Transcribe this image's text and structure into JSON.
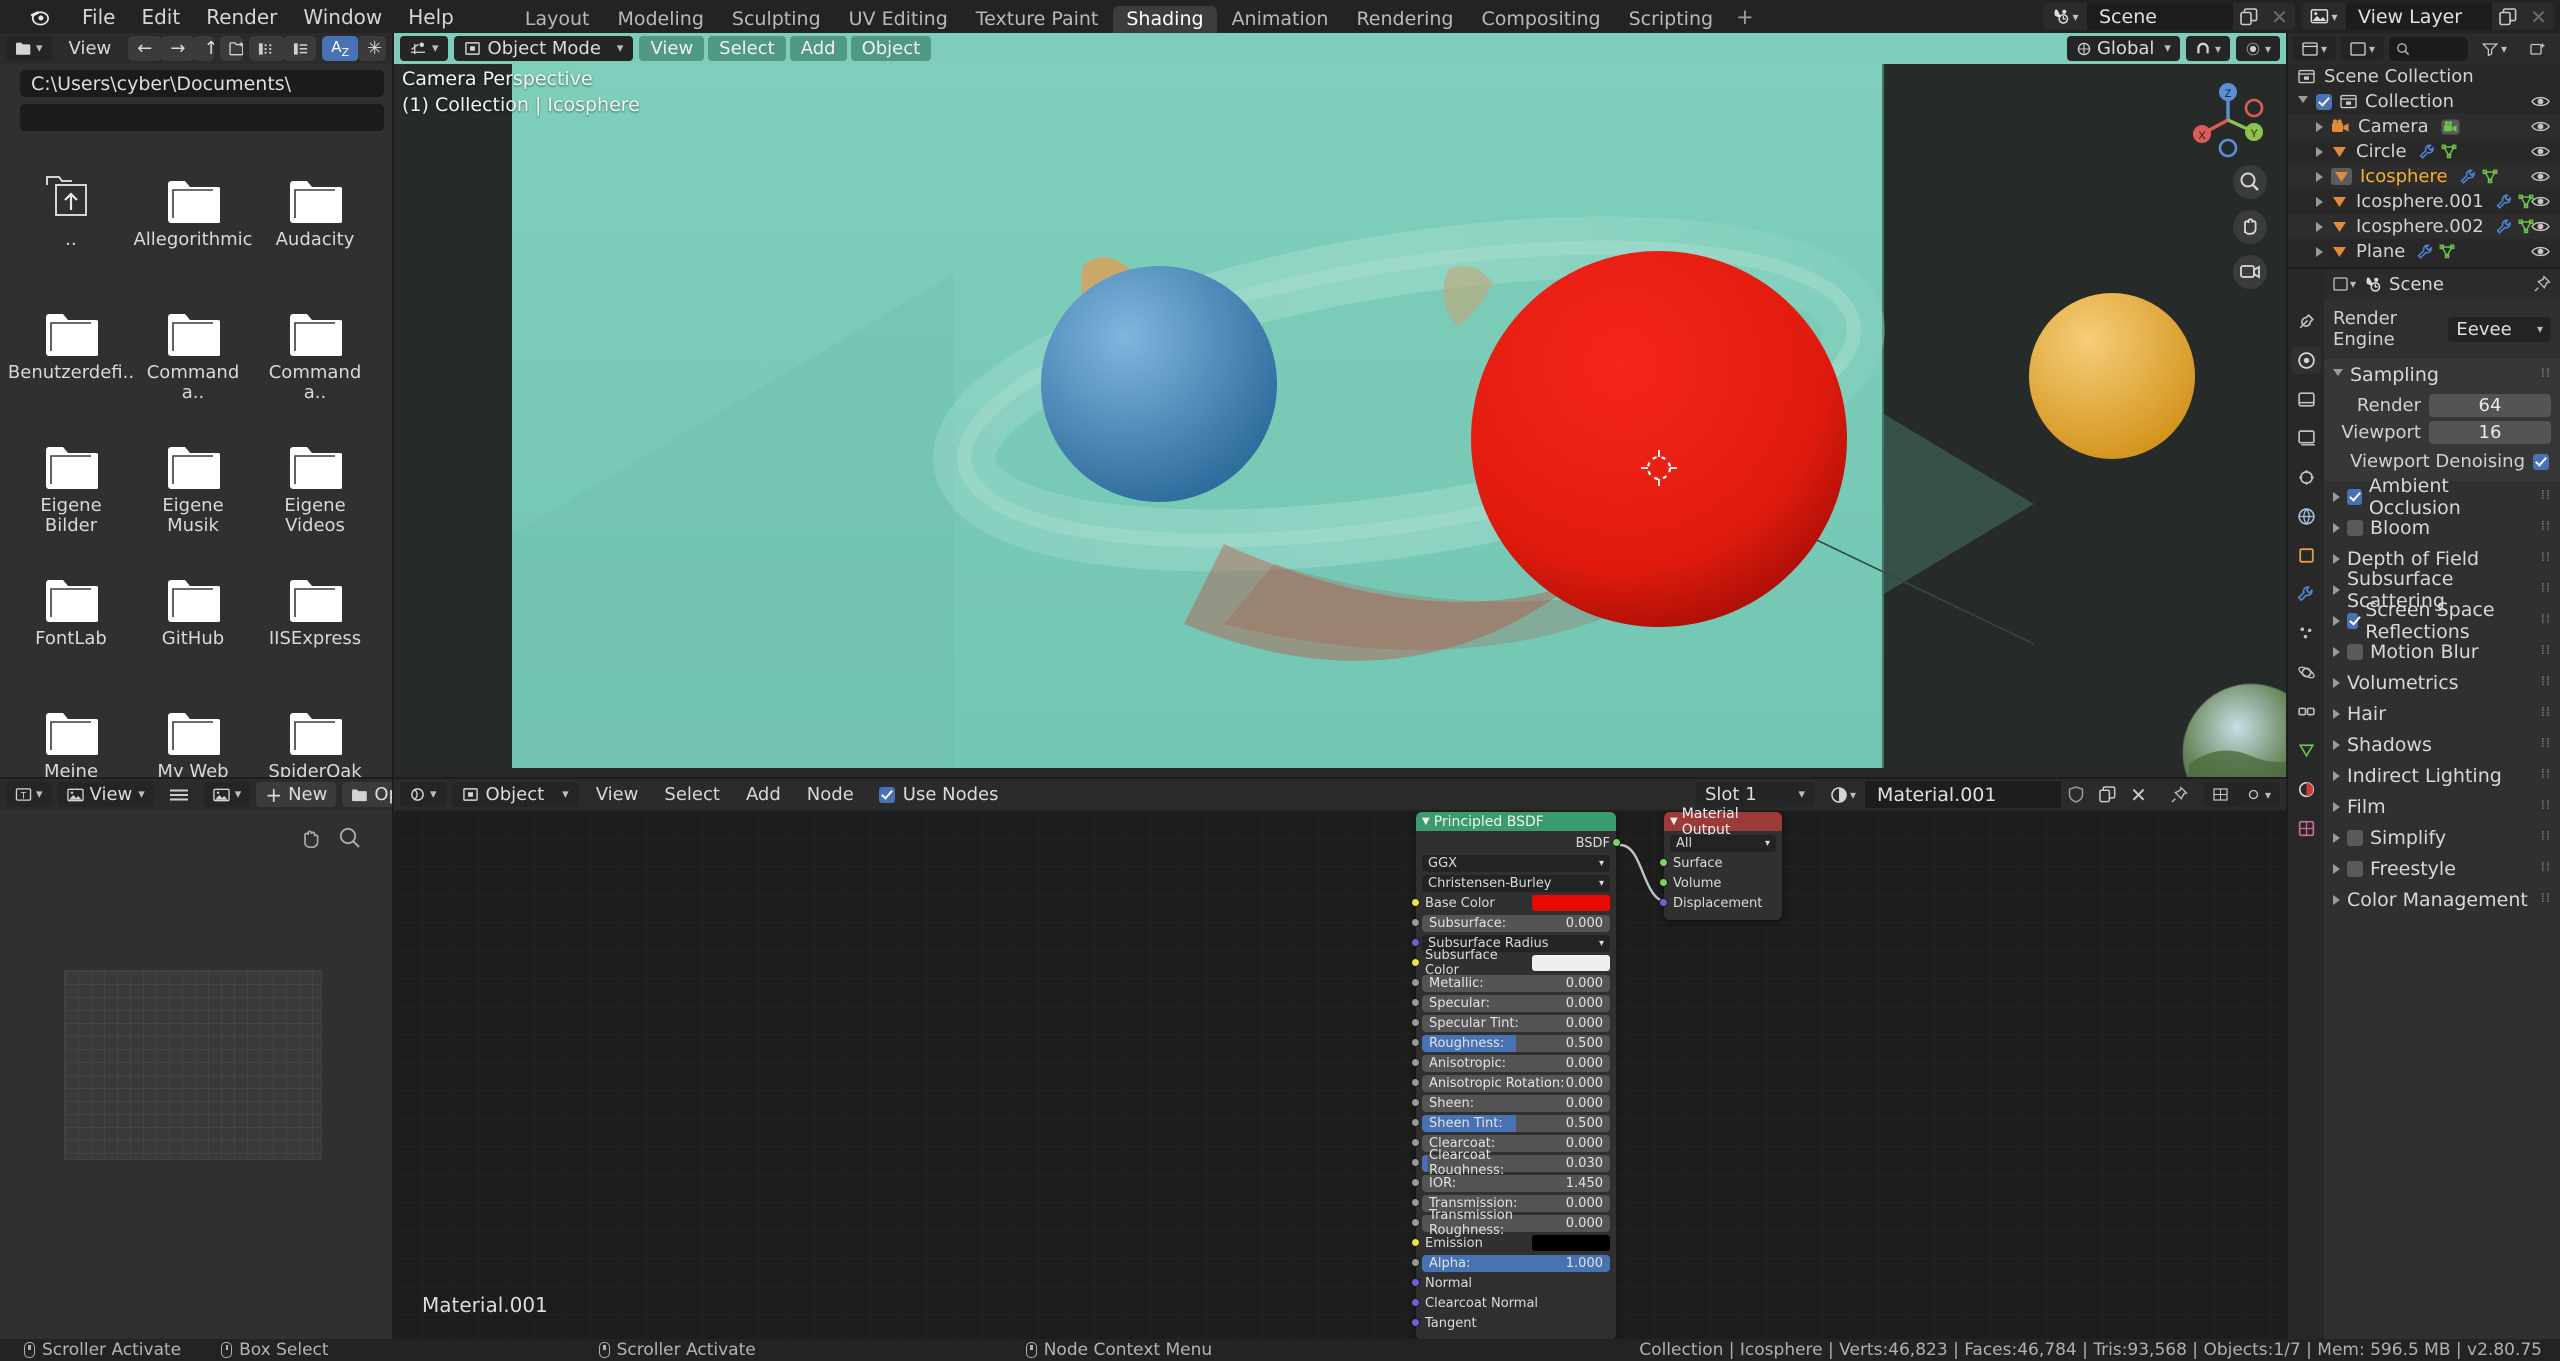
{
  "app": {
    "name": "Blender",
    "version_status": "v2.80.75"
  },
  "topbar": {
    "menus": [
      "File",
      "Edit",
      "Render",
      "Window",
      "Help"
    ],
    "workspace_tabs": [
      {
        "label": "Layout",
        "active": false
      },
      {
        "label": "Modeling",
        "active": false
      },
      {
        "label": "Sculpting",
        "active": false
      },
      {
        "label": "UV Editing",
        "active": false
      },
      {
        "label": "Texture Paint",
        "active": false
      },
      {
        "label": "Shading",
        "active": true
      },
      {
        "label": "Animation",
        "active": false
      },
      {
        "label": "Rendering",
        "active": false
      },
      {
        "label": "Compositing",
        "active": false
      },
      {
        "label": "Scripting",
        "active": false
      }
    ],
    "add_workspace_label": "+",
    "scene": {
      "label": "Scene",
      "icon": "scene-icon"
    },
    "view_layer": {
      "label": "View Layer",
      "icon": "view-layer-icon"
    }
  },
  "filebrowser": {
    "editor_type_icon": "file-browser-icon",
    "view_menu": "View",
    "path": "C:\\Users\\cyber\\Documents\\",
    "filename": "",
    "items": [
      {
        "label": "..",
        "icon": "parent-folder-icon"
      },
      {
        "label": "Allegorithmic",
        "icon": "folder-icon"
      },
      {
        "label": "Audacity",
        "icon": "folder-icon"
      },
      {
        "label": "Benutzerdefi..",
        "icon": "folder-icon"
      },
      {
        "label": "Command a..",
        "icon": "folder-icon"
      },
      {
        "label": "Command a..",
        "icon": "folder-icon"
      },
      {
        "label": "Eigene Bilder",
        "icon": "folder-icon"
      },
      {
        "label": "Eigene Musik",
        "icon": "folder-icon"
      },
      {
        "label": "Eigene Videos",
        "icon": "folder-icon"
      },
      {
        "label": "FontLab",
        "icon": "folder-icon"
      },
      {
        "label": "GitHub",
        "icon": "folder-icon"
      },
      {
        "label": "IISExpress",
        "icon": "folder-icon"
      },
      {
        "label": "Meine Shapes",
        "icon": "folder-icon"
      },
      {
        "label": "My Web Sites",
        "icon": "folder-icon"
      },
      {
        "label": "SpiderOak Hi..",
        "icon": "folder-icon"
      }
    ]
  },
  "image_editor": {
    "editor_type_icon": "image-editor-icon",
    "view_menu": "View",
    "image_icon": "image-icon",
    "new_label": "New",
    "open_label": "Open"
  },
  "viewport": {
    "mode": "Object Mode",
    "menus": [
      "View",
      "Select",
      "Add",
      "Object"
    ],
    "transform_orientation": "Global",
    "overlay_text_line1": "Camera Perspective",
    "overlay_text_line2": "(1) Collection | Icosphere",
    "gizmo_axes": [
      "X",
      "Y",
      "Z"
    ],
    "colors": {
      "world_bg": "#7fccbb",
      "sphere_blue": "#4a8fc9",
      "sphere_red": "#e01b0e",
      "sphere_orange": "#e8a838",
      "sphere_gray": "#9d9d9d"
    }
  },
  "shader_editor": {
    "editor_type_icon": "shader-editor-icon",
    "shader_type": "Object",
    "menus": [
      "View",
      "Select",
      "Add",
      "Node"
    ],
    "use_nodes_label": "Use Nodes",
    "use_nodes_checked": true,
    "slot": "Slot 1",
    "material": "Material.001",
    "material_label_overlay": "Material.001",
    "nodes": [
      {
        "name": "Principled BSDF",
        "header_color": "#3a9b6e",
        "output_socket": "BSDF",
        "dropdowns": [
          "GGX",
          "Christensen-Burley"
        ],
        "rows": [
          {
            "type": "color",
            "label": "Base Color",
            "color": "#e60c05",
            "socket": "yellow"
          },
          {
            "type": "value",
            "label": "Subsurface:",
            "value": "0.000",
            "fill": 0,
            "socket": "gray"
          },
          {
            "type": "dropdown",
            "label": "Subsurface Radius",
            "socket": "blue"
          },
          {
            "type": "color",
            "label": "Subsurface Color",
            "color": "#efefef",
            "socket": "yellow"
          },
          {
            "type": "value",
            "label": "Metallic:",
            "value": "0.000",
            "fill": 0,
            "socket": "gray"
          },
          {
            "type": "value",
            "label": "Specular:",
            "value": "0.000",
            "fill": 0,
            "socket": "gray"
          },
          {
            "type": "value",
            "label": "Specular Tint:",
            "value": "0.000",
            "fill": 0,
            "socket": "gray"
          },
          {
            "type": "value",
            "label": "Roughness:",
            "value": "0.500",
            "fill": 50,
            "socket": "gray"
          },
          {
            "type": "value",
            "label": "Anisotropic:",
            "value": "0.000",
            "fill": 0,
            "socket": "gray"
          },
          {
            "type": "value",
            "label": "Anisotropic Rotation:",
            "value": "0.000",
            "fill": 0,
            "socket": "gray"
          },
          {
            "type": "value",
            "label": "Sheen:",
            "value": "0.000",
            "fill": 0,
            "socket": "gray"
          },
          {
            "type": "value",
            "label": "Sheen Tint:",
            "value": "0.500",
            "fill": 50,
            "socket": "gray"
          },
          {
            "type": "value",
            "label": "Clearcoat:",
            "value": "0.000",
            "fill": 0,
            "socket": "gray"
          },
          {
            "type": "value",
            "label": "Clearcoat Roughness:",
            "value": "0.030",
            "fill": 3,
            "socket": "gray"
          },
          {
            "type": "value",
            "label": "IOR:",
            "value": "1.450",
            "fill": 0,
            "socket": "gray"
          },
          {
            "type": "value",
            "label": "Transmission:",
            "value": "0.000",
            "fill": 0,
            "socket": "gray"
          },
          {
            "type": "value",
            "label": "Transmission Roughness:",
            "value": "0.000",
            "fill": 0,
            "socket": "gray"
          },
          {
            "type": "color",
            "label": "Emission",
            "color": "#000000",
            "socket": "yellow"
          },
          {
            "type": "value",
            "label": "Alpha:",
            "value": "1.000",
            "fill": 100,
            "socket": "gray"
          },
          {
            "type": "plain",
            "label": "Normal",
            "socket": "blue"
          },
          {
            "type": "plain",
            "label": "Clearcoat Normal",
            "socket": "blue"
          },
          {
            "type": "plain",
            "label": "Tangent",
            "socket": "blue"
          }
        ]
      },
      {
        "name": "Material Output",
        "header_color": "#9c3a3a",
        "dropdown": "All",
        "inputs": [
          {
            "label": "Surface",
            "socket": "green"
          },
          {
            "label": "Volume",
            "socket": "green"
          },
          {
            "label": "Displacement",
            "socket": "blue"
          }
        ]
      }
    ]
  },
  "outliner": {
    "display_mode_icon": "outliner-icon",
    "search_placeholder": "",
    "root": "Scene Collection",
    "rows": [
      {
        "indent": 0,
        "label": "Collection",
        "icon": "collection-icon",
        "checkbox": true,
        "expand": "down",
        "selected": false,
        "mods": []
      },
      {
        "indent": 1,
        "label": "Camera",
        "icon": "camera-icon",
        "expand": "right",
        "selected": false,
        "mods": [
          "camera-data-icon"
        ]
      },
      {
        "indent": 1,
        "label": "Circle",
        "icon": "mesh-icon",
        "expand": "right",
        "selected": false,
        "mods": [
          "wrench-icon",
          "mesh-data-icon"
        ]
      },
      {
        "indent": 1,
        "label": "Icosphere",
        "icon": "mesh-icon",
        "expand": "right",
        "selected": true,
        "mods": [
          "wrench-icon",
          "mesh-data-icon"
        ]
      },
      {
        "indent": 1,
        "label": "Icosphere.001",
        "icon": "mesh-icon",
        "expand": "right",
        "selected": false,
        "mods": [
          "wrench-icon",
          "mesh-data-icon"
        ]
      },
      {
        "indent": 1,
        "label": "Icosphere.002",
        "icon": "mesh-icon",
        "expand": "right",
        "selected": false,
        "mods": [
          "wrench-icon",
          "mesh-data-icon"
        ]
      },
      {
        "indent": 1,
        "label": "Plane",
        "icon": "mesh-icon",
        "expand": "right",
        "selected": false,
        "mods": [
          "wrench-icon",
          "mesh-data-icon"
        ]
      }
    ]
  },
  "properties": {
    "breadcrumb": "Scene",
    "breadcrumb_icon": "scene-icon",
    "pin_icon": "pin-icon",
    "render_engine_label": "Render Engine",
    "render_engine_value": "Eevee",
    "sampling": {
      "title": "Sampling",
      "render_label": "Render",
      "render_value": "64",
      "viewport_label": "Viewport",
      "viewport_value": "16",
      "denoise_label": "Viewport Denoising",
      "denoise_checked": true
    },
    "panels": [
      {
        "label": "Ambient Occlusion",
        "checkbox": true,
        "checked": true
      },
      {
        "label": "Bloom",
        "checkbox": true,
        "checked": false
      },
      {
        "label": "Depth of Field",
        "checkbox": false
      },
      {
        "label": "Subsurface Scattering",
        "checkbox": false
      },
      {
        "label": "Screen Space Reflections",
        "checkbox": true,
        "checked": true
      },
      {
        "label": "Motion Blur",
        "checkbox": true,
        "checked": false
      },
      {
        "label": "Volumetrics",
        "checkbox": false
      },
      {
        "label": "Hair",
        "checkbox": false
      },
      {
        "label": "Shadows",
        "checkbox": false
      },
      {
        "label": "Indirect Lighting",
        "checkbox": false
      },
      {
        "label": "Film",
        "checkbox": false
      },
      {
        "label": "Simplify",
        "checkbox": true,
        "checked": false
      },
      {
        "label": "Freestyle",
        "checkbox": true,
        "checked": false
      },
      {
        "label": "Color Management",
        "checkbox": false
      }
    ],
    "tab_icons": [
      "tool-icon",
      "render-icon",
      "output-icon",
      "view-layer-tab-icon",
      "scene-tab-icon",
      "world-icon",
      "object-icon",
      "modifier-icon",
      "particles-icon",
      "physics-icon",
      "constraints-icon",
      "data-icon",
      "material-icon",
      "texture-icon"
    ]
  },
  "statusbar": {
    "hints": [
      {
        "icon": "mouse-left-icon",
        "label": "Scroller Activate"
      },
      {
        "icon": "mouse-middle-icon",
        "label": "Box Select"
      },
      {
        "icon": "mouse-left-icon",
        "label": "Scroller Activate"
      },
      {
        "icon": "mouse-right-icon",
        "label": "Node Context Menu"
      }
    ],
    "info": "Collection | Icosphere | Verts:46,823 | Faces:46,784 | Tris:93,568 | Objects:1/7 | Mem: 596.5 MB | v2.80.75"
  }
}
